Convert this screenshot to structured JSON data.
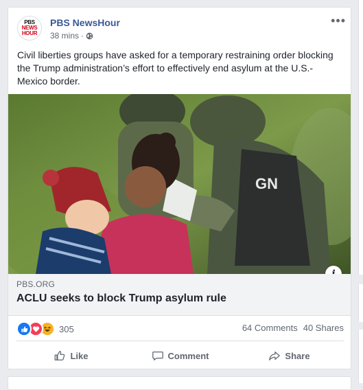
{
  "post": {
    "page_name": "PBS NewsHour",
    "timestamp": "38 mins",
    "separator": "·",
    "privacy_icon": "globe-icon",
    "more_icon": "more-horizontal-icon",
    "more_label": "•••",
    "text": "Civil liberties groups have asked for a temporary restraining order blocking the Trump administration’s effort to effectively end asylum at the U.S.-Mexico border.",
    "avatar": {
      "line1": "PBS",
      "line2": "NEWS",
      "line3": "HOUR"
    }
  },
  "link_preview": {
    "domain": "PBS.ORG",
    "headline": "ACLU seeks to block Trump asylum rule",
    "info_label": "i",
    "image_icon": "news-photo"
  },
  "engagement": {
    "reactions": [
      "like-reaction-icon",
      "love-reaction-icon",
      "haha-reaction-icon"
    ],
    "reaction_count": "305",
    "comments": "64 Comments",
    "shares": "40 Shares"
  },
  "actions": {
    "like": "Like",
    "comment": "Comment",
    "share": "Share"
  },
  "colors": {
    "page_name": "#385898",
    "like": "#1877f2",
    "love": "#f33e58",
    "haha": "#f7b125",
    "muted": "#606770"
  }
}
